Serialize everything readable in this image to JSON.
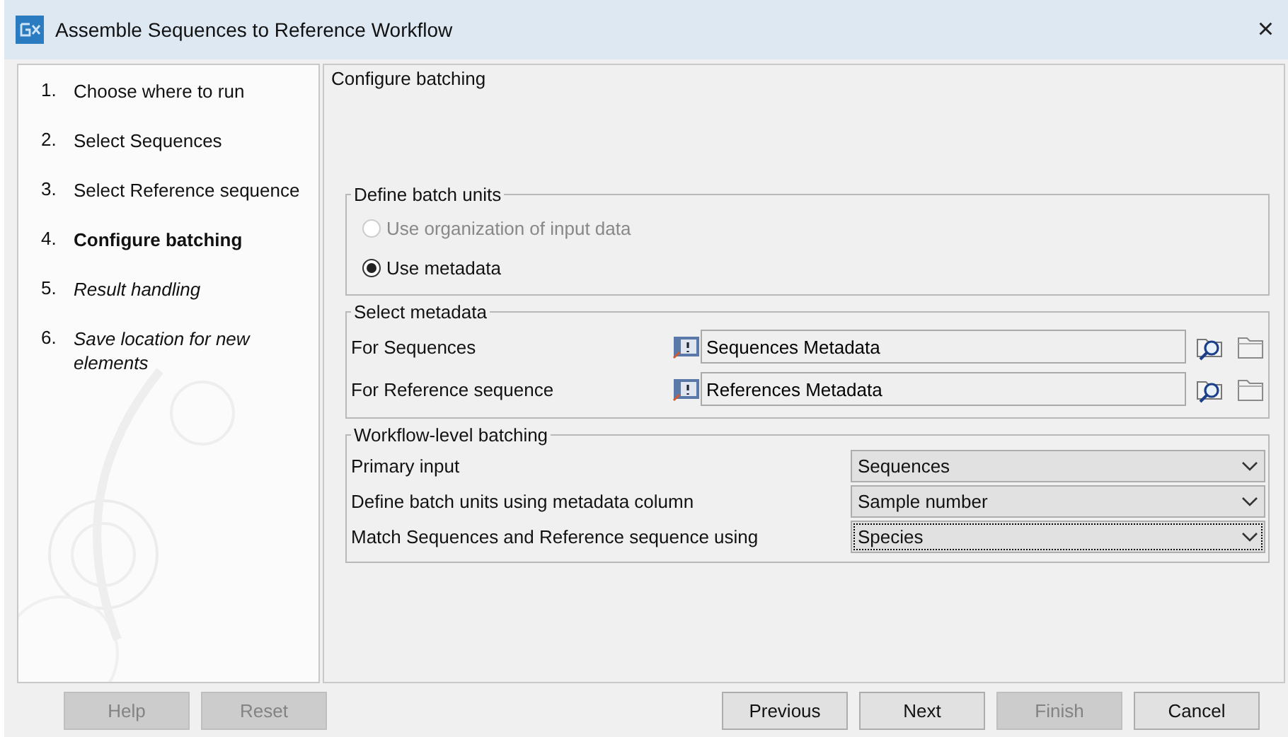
{
  "window": {
    "title": "Assemble Sequences to Reference Workflow",
    "close": "×"
  },
  "steps": [
    {
      "number": "1.",
      "label": "Choose where to run",
      "kind": "done"
    },
    {
      "number": "2.",
      "label": "Select Sequences",
      "kind": "done"
    },
    {
      "number": "3.",
      "label": "Select Reference sequence",
      "kind": "done"
    },
    {
      "number": "4.",
      "label": "Configure batching",
      "kind": "current"
    },
    {
      "number": "5.",
      "label": "Result handling",
      "kind": "pending"
    },
    {
      "number": "6.",
      "label": "Save location for new elements",
      "kind": "pending"
    }
  ],
  "page_title": "Configure batching",
  "batch_units": {
    "title": "Define batch units",
    "options": [
      {
        "label": "Use organization of input data",
        "selected": false,
        "disabled": true
      },
      {
        "label": "Use metadata",
        "selected": true,
        "disabled": false
      }
    ]
  },
  "select_metadata": {
    "title": "Select metadata",
    "rows": [
      {
        "label": "For Sequences",
        "value": "Sequences Metadata"
      },
      {
        "label": "For Reference sequence",
        "value": "References Metadata"
      }
    ]
  },
  "workflow_batching": {
    "title": "Workflow-level batching",
    "rows": [
      {
        "label": "Primary input",
        "value": "Sequences",
        "focused": false
      },
      {
        "label": "Define batch units using metadata column",
        "value": "Sample number",
        "focused": false
      },
      {
        "label": "Match Sequences and Reference sequence using",
        "value": "Species",
        "focused": true
      }
    ]
  },
  "left_buttons": [
    {
      "label": "Help",
      "disabled": true
    },
    {
      "label": "Reset",
      "disabled": true
    }
  ],
  "right_buttons": [
    {
      "label": "Previous",
      "disabled": false
    },
    {
      "label": "Next",
      "disabled": false
    },
    {
      "label": "Finish",
      "disabled": true
    },
    {
      "label": "Cancel",
      "disabled": false
    }
  ]
}
